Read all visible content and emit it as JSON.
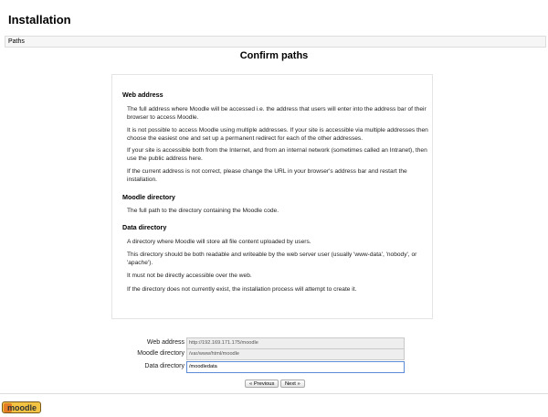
{
  "header": {
    "title": "Installation"
  },
  "breadcrumb": {
    "label": "Paths"
  },
  "page": {
    "heading": "Confirm paths"
  },
  "info": {
    "web_address": {
      "title": "Web address",
      "paragraphs": [
        "The full address where Moodle will be accessed i.e. the address that users will enter into the address bar of their browser to access Moodle.",
        "It is not possible to access Moodle using multiple addresses. If your site is accessible via multiple addresses then choose the easiest one and set up a permanent redirect for each of the other addresses.",
        "If your site is accessible both from the Internet, and from an internal network (sometimes called an Intranet), then use the public address here.",
        "If the current address is not correct, please change the URL in your browser's address bar and restart the installation."
      ]
    },
    "moodle_directory": {
      "title": "Moodle directory",
      "paragraphs": [
        "The full path to the directory containing the Moodle code."
      ]
    },
    "data_directory": {
      "title": "Data directory",
      "paragraphs": [
        "A directory where Moodle will store all file content uploaded by users.",
        "This directory should be both readable and writeable by the web server user (usually 'www-data', 'nobody', or 'apache').",
        "It must not be directly accessible over the web.",
        "If the directory does not currently exist, the installation process will attempt to create it."
      ]
    }
  },
  "form": {
    "web_address": {
      "label": "Web address",
      "value": "http://192.169.171.175/moodle"
    },
    "moodle_directory": {
      "label": "Moodle directory",
      "value": "/var/www/html/moodle"
    },
    "data_directory": {
      "label": "Data directory",
      "value": "/moodledata"
    }
  },
  "buttons": {
    "previous": "« Previous",
    "next": "Next »"
  },
  "footer": {
    "logo_text": "moodle"
  },
  "colors": {
    "logo_bg": "#f3c443",
    "logo_mark": "#e47d25",
    "active_border": "#5c8bd8"
  }
}
